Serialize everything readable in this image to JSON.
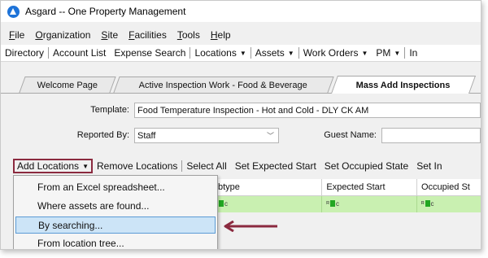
{
  "window": {
    "title": "Asgard -- One Property Management"
  },
  "menu": [
    "File",
    "Organization",
    "Site",
    "Facilities",
    "Tools",
    "Help"
  ],
  "toolbar": {
    "directory": "Directory",
    "account_list": "Account List",
    "expense_search": "Expense Search",
    "locations": "Locations",
    "assets": "Assets",
    "work_orders": "Work Orders",
    "pm": "PM",
    "in": "In"
  },
  "tabs": [
    {
      "label": "Welcome Page",
      "active": false
    },
    {
      "label": "Active Inspection Work - Food & Beverage",
      "active": false
    },
    {
      "label": "Mass Add Inspections",
      "active": true
    }
  ],
  "form": {
    "template_label": "Template:",
    "template_value": "Food Temperature Inspection - Hot and Cold - DLY CK AM",
    "reported_by_label": "Reported By:",
    "reported_by_value": "Staff",
    "guest_name_label": "Guest Name:",
    "guest_name_value": ""
  },
  "commands": {
    "add_locations": "Add Locations",
    "remove_locations": "Remove Locations",
    "select_all": "Select All",
    "set_expected_start": "Set Expected Start",
    "set_occupied_state": "Set Occupied State",
    "set_in": "Set In"
  },
  "grid": {
    "columns": [
      "btype",
      "Expected Start",
      "Occupied St"
    ],
    "row": [
      "c",
      "c",
      "c"
    ]
  },
  "dropdown": {
    "items": [
      "From an Excel spreadsheet...",
      "Where assets are found...",
      "By searching...",
      "From location tree..."
    ],
    "highlighted_index": 2
  },
  "colors": {
    "accent_outline": "#8b2a3f",
    "row_highlight": "#c9f0b1",
    "menu_highlight": "#cce4f7"
  }
}
